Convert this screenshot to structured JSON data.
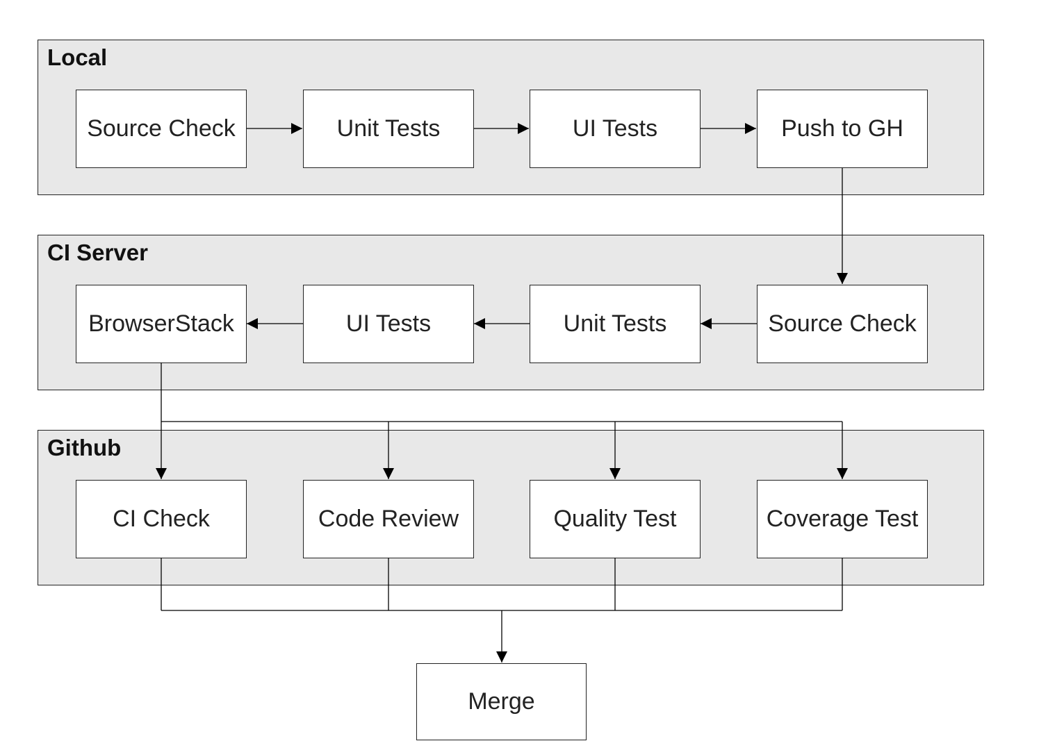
{
  "groups": [
    {
      "id": "local",
      "title": "Local",
      "nodes": [
        "Source Check",
        "Unit Tests",
        "UI Tests",
        "Push to GH"
      ]
    },
    {
      "id": "ci",
      "title": "CI Server",
      "nodes": [
        "BrowserStack",
        "UI Tests",
        "Unit Tests",
        "Source Check"
      ]
    },
    {
      "id": "github",
      "title": "Github",
      "nodes": [
        "CI Check",
        "Code Review",
        "Quality Test",
        "Coverage Test"
      ]
    }
  ],
  "final": {
    "label": "Merge"
  },
  "edges": [
    {
      "from": "local.Source Check",
      "to": "local.Unit Tests"
    },
    {
      "from": "local.Unit Tests",
      "to": "local.UI Tests"
    },
    {
      "from": "local.UI Tests",
      "to": "local.Push to GH"
    },
    {
      "from": "local.Push to GH",
      "to": "ci.Source Check"
    },
    {
      "from": "ci.Source Check",
      "to": "ci.Unit Tests"
    },
    {
      "from": "ci.Unit Tests",
      "to": "ci.UI Tests"
    },
    {
      "from": "ci.UI Tests",
      "to": "ci.BrowserStack"
    },
    {
      "from": "ci.BrowserStack",
      "to": "github.CI Check"
    },
    {
      "from": "ci.BrowserStack",
      "to": "github.Code Review"
    },
    {
      "from": "ci.BrowserStack",
      "to": "github.Quality Test"
    },
    {
      "from": "ci.BrowserStack",
      "to": "github.Coverage Test"
    },
    {
      "from": "github.*",
      "to": "Merge"
    }
  ]
}
